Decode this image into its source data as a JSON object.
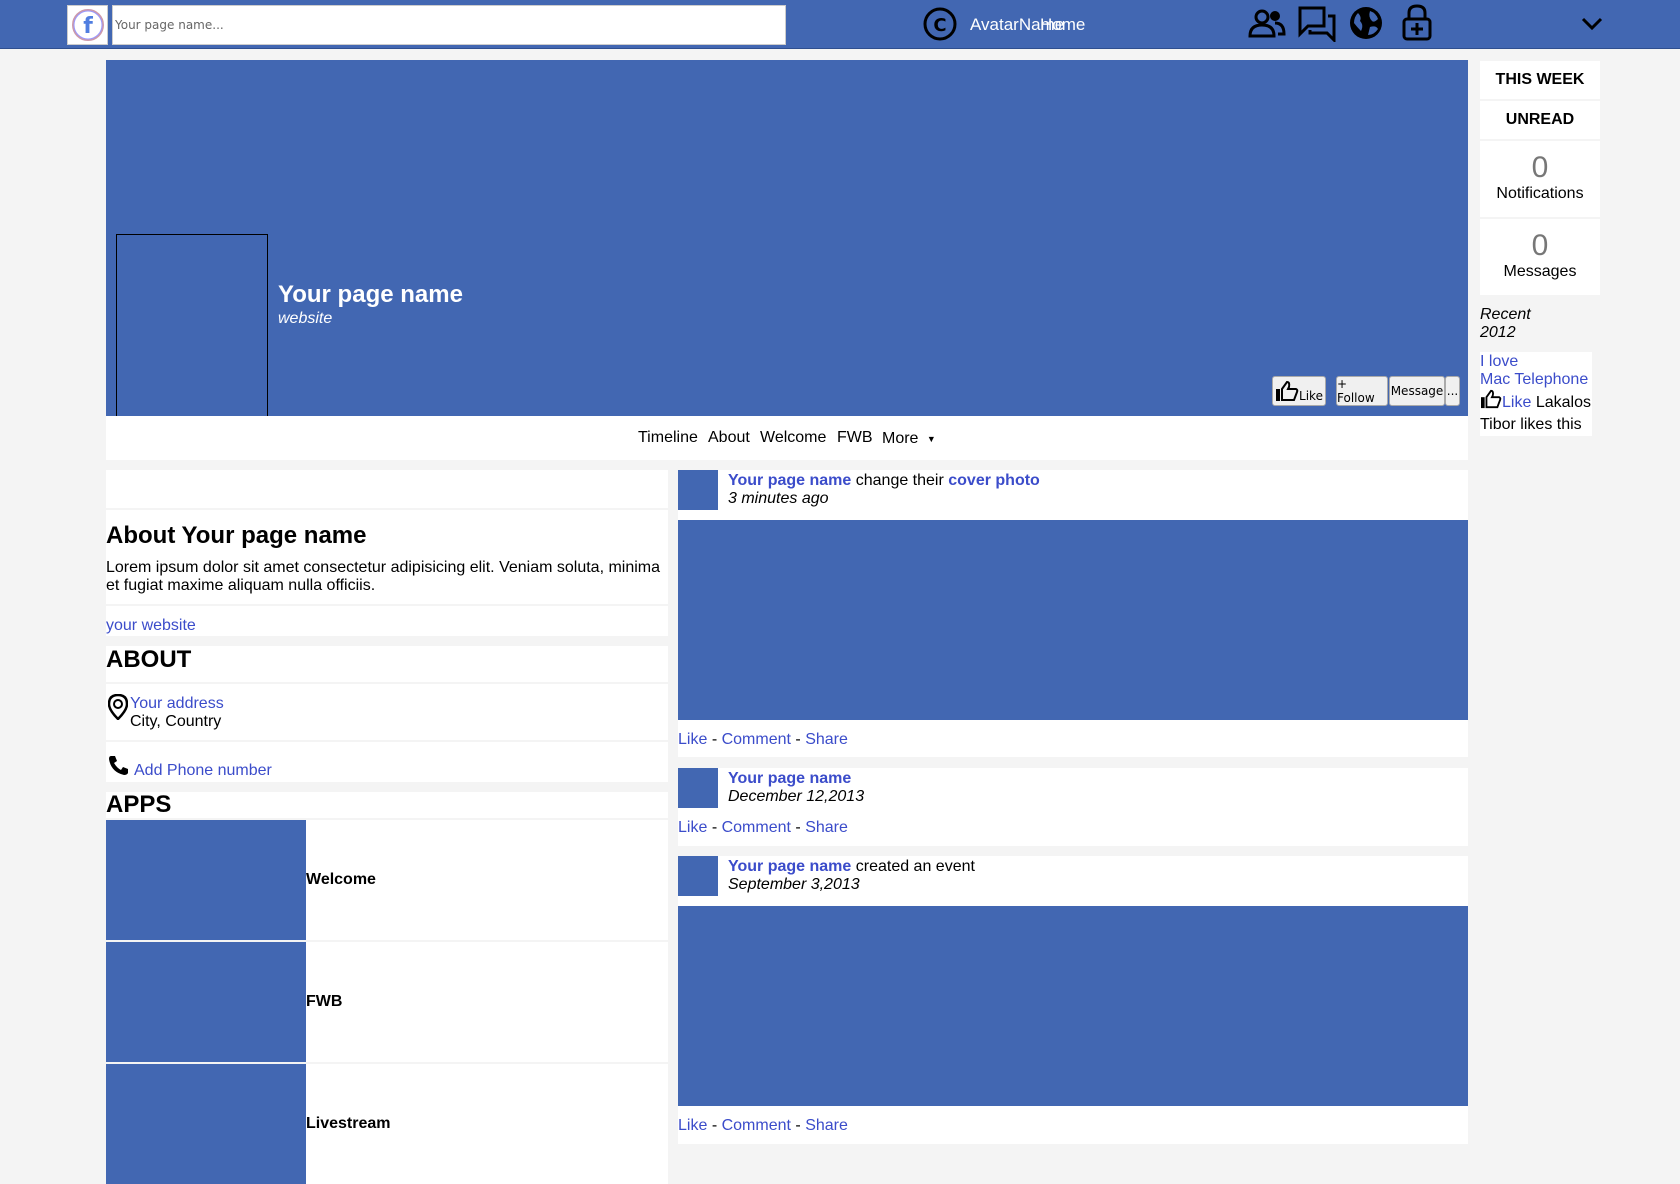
{
  "topbar": {
    "search_placeholder": "Your page name...",
    "avatar_name": "AvatarName",
    "home_label": "Home"
  },
  "cover": {
    "page_name": "Your page name",
    "website": "website",
    "like_label": "Like",
    "follow_label": "+ Follow",
    "message_label": "Message",
    "more_label": "..."
  },
  "nav": {
    "tabs": [
      "Timeline",
      "About",
      "Welcome",
      "FWB",
      "More"
    ],
    "more_arrow": "▼"
  },
  "about": {
    "title": "About Your page name",
    "description": "Lorem ipsum dolor sit amet consectetur adipisicing elit. Veniam soluta, minima et fugiat maxime aliquam nulla officiis.",
    "website_link": "your website",
    "section_title": "ABOUT",
    "address_link": "Your address",
    "city": "City, Country",
    "phone_link": "Add Phone number"
  },
  "apps": {
    "title": "APPS",
    "items": [
      "Welcome",
      "FWB",
      "Livestream"
    ]
  },
  "feed": {
    "posts": [
      {
        "author": "Your page name",
        "text": " change their ",
        "link": "cover photo",
        "time": "3 minutes ago"
      },
      {
        "author": "Your page name",
        "text": "",
        "link": "",
        "time": "December 12,2013"
      },
      {
        "author": "Your page name",
        "text": " created an event",
        "link": "",
        "time": "September 3,2013"
      }
    ],
    "action_like": "Like",
    "action_comment": "Comment",
    "action_share": "Share",
    "separator": "-"
  },
  "sidebar": {
    "this_week": "THIS WEEK",
    "unread": "UNREAD",
    "notifications_count": "0",
    "notifications_label": "Notifications",
    "messages_count": "0",
    "messages_label": "Messages",
    "recent": "Recent",
    "year": "2012",
    "love_line1": "I love",
    "love_line2": "Mac Telephone",
    "like_label": "Like",
    "likes_name": "Lakalos",
    "likes_text": "Tibor likes this"
  },
  "colors": {
    "brand": "#4267b2",
    "link": "#3b4cca"
  }
}
